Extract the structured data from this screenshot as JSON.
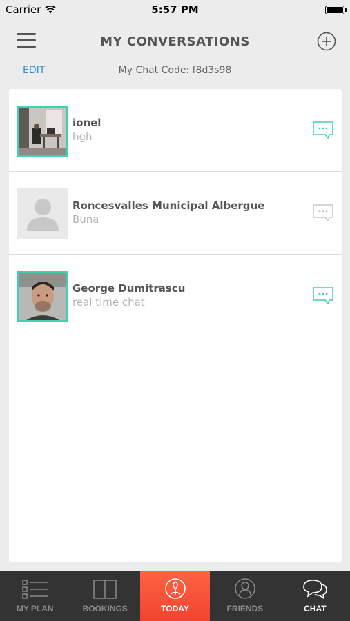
{
  "status_bar": {
    "carrier": "Carrier",
    "time": "5:57 PM"
  },
  "header": {
    "title": "MY CONVERSATIONS"
  },
  "subheader": {
    "edit_label": "EDIT",
    "chat_code": "My Chat Code: f8d3s98"
  },
  "conversations": [
    {
      "name": "ionel",
      "last_message": "hgh",
      "avatar": "photo-workspace",
      "unread": true
    },
    {
      "name": "Roncesvalles Municipal Albergue",
      "last_message": "Buna",
      "avatar": "placeholder-person",
      "unread": false
    },
    {
      "name": "George Dumitrascu",
      "last_message": "real time chat",
      "avatar": "photo-face",
      "unread": true
    }
  ],
  "tabs": [
    {
      "label": "MY PLAN",
      "icon": "list-icon"
    },
    {
      "label": "BOOKINGS",
      "icon": "book-icon"
    },
    {
      "label": "TODAY",
      "icon": "compass-icon"
    },
    {
      "label": "FRIENDS",
      "icon": "person-icon"
    },
    {
      "label": "CHAT",
      "icon": "chat-bubbles-icon"
    }
  ],
  "colors": {
    "accent_teal": "#3fd1b0",
    "today_red": "#f2432f",
    "link_blue": "#2f8fdc",
    "tabbar_bg": "#333333"
  }
}
